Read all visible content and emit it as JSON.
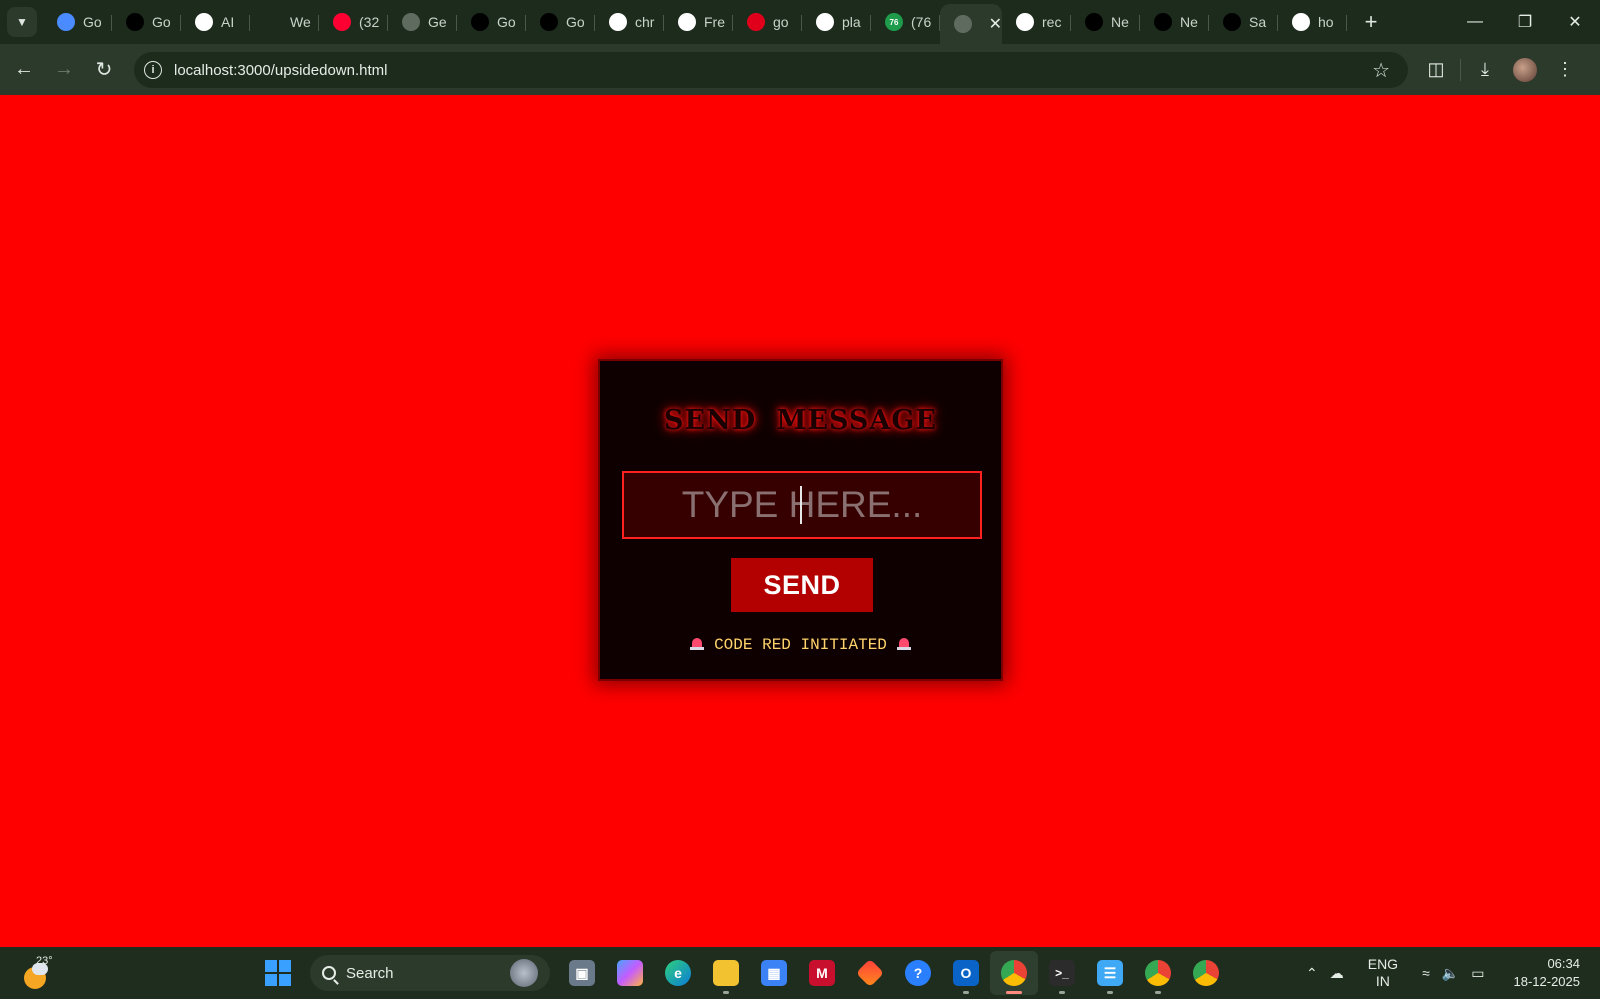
{
  "browser": {
    "tabs": [
      {
        "title": "Go",
        "icon": "gemini-icon",
        "color": "#4a8cff"
      },
      {
        "title": "Go",
        "icon": "external-app-icon",
        "color": "#000000"
      },
      {
        "title": "AI",
        "icon": "pause-app-icon",
        "color": "#ffffff"
      },
      {
        "title": "We",
        "icon": "openai-icon",
        "color": "#1c2b1c"
      },
      {
        "title": "(32",
        "icon": "youtube-icon",
        "color": "#ff0033"
      },
      {
        "title": "Ge",
        "icon": "globe-icon",
        "color": "#5f6b5f"
      },
      {
        "title": "Go",
        "icon": "external-app-icon",
        "color": "#000000"
      },
      {
        "title": "Go",
        "icon": "external-app-icon",
        "color": "#000000"
      },
      {
        "title": "chr",
        "icon": "google-icon",
        "color": "#ffffff"
      },
      {
        "title": "Fre",
        "icon": "bars-icon",
        "color": "#ffffff"
      },
      {
        "title": "go",
        "icon": "n-app-icon",
        "color": "#e0001b"
      },
      {
        "title": "pla",
        "icon": "google-icon",
        "color": "#ffffff"
      },
      {
        "title": "(76",
        "icon": "counter-icon",
        "color": "#1e9b4b",
        "badge": "76"
      },
      {
        "title": "",
        "icon": "globe-icon",
        "color": "#5f6b5f",
        "active": true
      },
      {
        "title": "rec",
        "icon": "google-icon",
        "color": "#ffffff"
      },
      {
        "title": "Ne",
        "icon": "triangle-icon",
        "color": "#000000"
      },
      {
        "title": "Ne",
        "icon": "github-icon",
        "color": "#000000"
      },
      {
        "title": "Sa",
        "icon": "github-icon",
        "color": "#000000"
      },
      {
        "title": "ho",
        "icon": "google-icon",
        "color": "#ffffff"
      }
    ],
    "url": "localhost:3000/upsidedown.html"
  },
  "card": {
    "title": "SEND MESSAGE",
    "input_placeholder": "TYPE HERE...",
    "send_label": "SEND",
    "status_text": "CODE RED INITIATED"
  },
  "taskbar": {
    "temperature": "23°",
    "search_label": "Search",
    "lang_top": "ENG",
    "lang_bottom": "IN",
    "time": "06:34",
    "date": "18-12-2025"
  },
  "colors": {
    "page_background": "#ff0000",
    "card_background": "#0e0000",
    "accent_red": "#b30000",
    "status_yellow": "#ffd36b"
  }
}
